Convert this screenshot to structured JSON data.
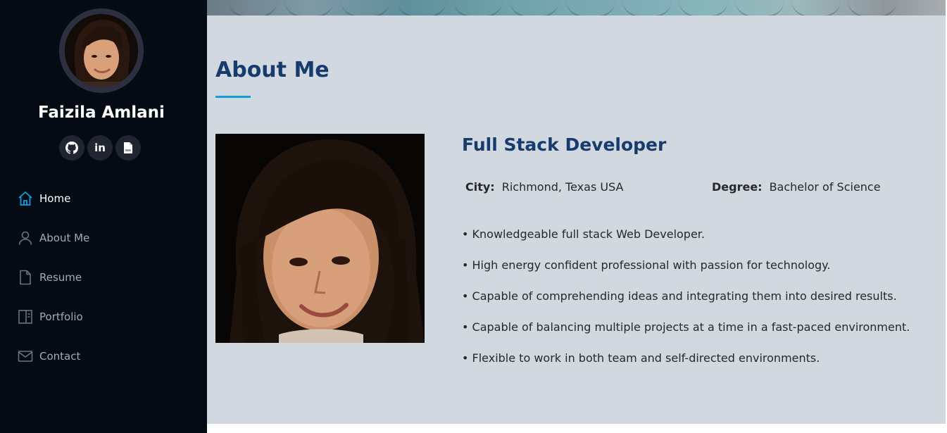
{
  "profile": {
    "name": "Faizila Amlani",
    "avatar_alt": "Portrait of Faizila Amlani"
  },
  "social": [
    {
      "name": "github",
      "icon": "github-icon"
    },
    {
      "name": "linkedin",
      "icon": "linkedin-icon",
      "glyph": "in"
    },
    {
      "name": "resume-file",
      "icon": "file-icon"
    }
  ],
  "nav": [
    {
      "label": "Home",
      "icon": "home-icon",
      "active": true
    },
    {
      "label": "About Me",
      "icon": "person-icon",
      "active": false
    },
    {
      "label": "Resume",
      "icon": "file-icon",
      "active": false
    },
    {
      "label": "Portfolio",
      "icon": "portfolio-icon",
      "active": false
    },
    {
      "label": "Contact",
      "icon": "envelope-icon",
      "active": false
    }
  ],
  "about": {
    "title": "About Me",
    "job_title": "Full Stack Developer",
    "info": [
      {
        "key": "City:",
        "value": "Richmond, Texas USA"
      },
      {
        "key": "Degree:",
        "value": "Bachelor of Science"
      }
    ],
    "bullets": [
      "• Knowledgeable full stack Web Developer.",
      "• High energy confident professional with passion for technology.",
      "• Capable of comprehending ideas and integrating them into desired results.",
      "• Capable of balancing multiple projects at a time in a fast-paced environment.",
      "• Flexible to work in both team and self-directed environments."
    ]
  },
  "colors": {
    "sidebar_bg": "#040b14",
    "main_bg": "#d1d8df",
    "heading": "#173b6c",
    "accent": "#149ddd",
    "nav_text": "#a8a9b4",
    "body_text": "#272829"
  }
}
